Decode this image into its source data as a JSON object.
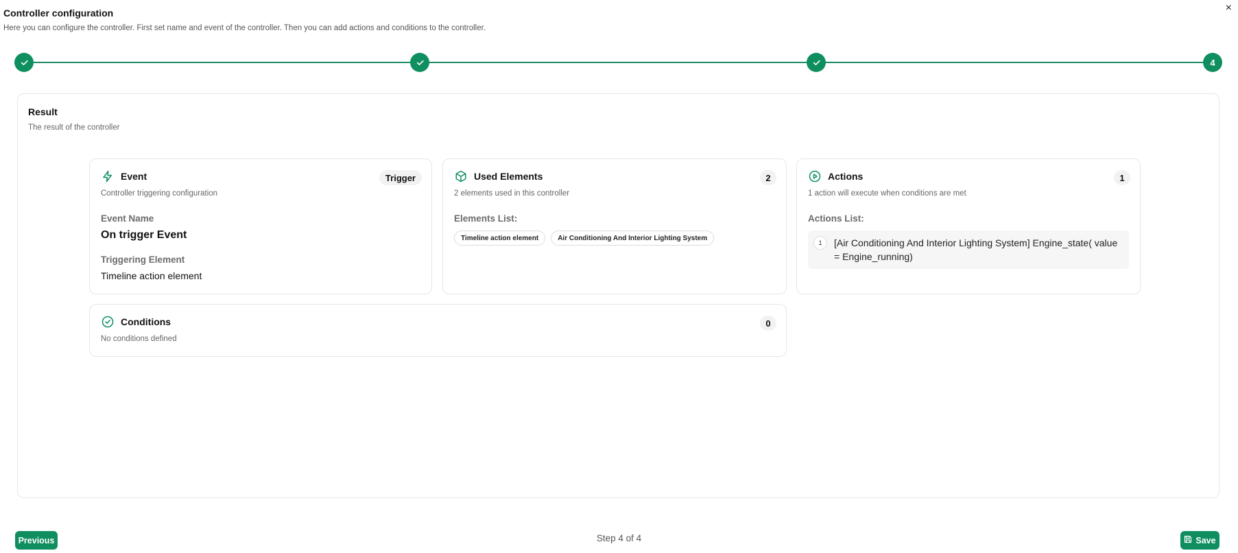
{
  "header": {
    "title": "Controller configuration",
    "subtitle": "Here you can configure the controller. First set name and event of the controller. Then you can add actions and conditions to the controller.",
    "close": "×"
  },
  "stepper": {
    "steps": [
      "done",
      "done",
      "done",
      "4"
    ],
    "accent": "#0f8f5f"
  },
  "result": {
    "title": "Result",
    "subtitle": "The result of the controller"
  },
  "event_card": {
    "title": "Event",
    "badge": "Trigger",
    "desc": "Controller triggering configuration",
    "event_name_label": "Event Name",
    "event_name_value": "On trigger Event",
    "triggering_label": "Triggering Element",
    "triggering_value": "Timeline action element"
  },
  "elements_card": {
    "title": "Used Elements",
    "badge": "2",
    "desc": "2 elements used in this controller",
    "list_label": "Elements List:",
    "items": [
      "Timeline action element",
      "Air Conditioning And Interior Lighting System"
    ]
  },
  "actions_card": {
    "title": "Actions",
    "badge": "1",
    "desc": "1 action will execute when conditions are met",
    "list_label": "Actions List:",
    "items": [
      {
        "num": "1",
        "text": "[Air Conditioning And Interior Lighting System] Engine_state( value = Engine_running)"
      }
    ]
  },
  "conditions_card": {
    "title": "Conditions",
    "badge": "0",
    "desc": "No conditions defined"
  },
  "footer": {
    "previous": "Previous",
    "step_info": "Step 4 of 4",
    "save": "Save"
  }
}
